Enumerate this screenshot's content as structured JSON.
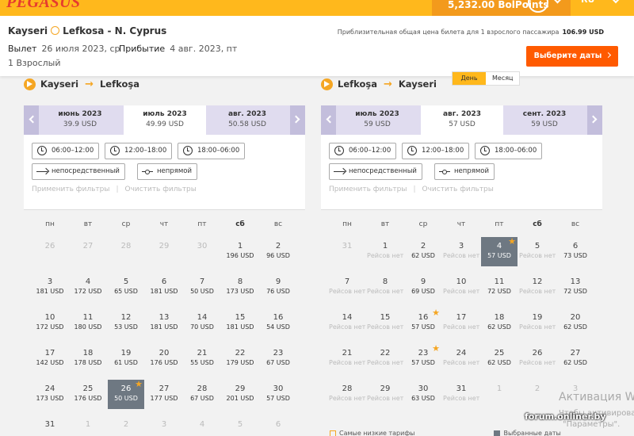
{
  "header": {
    "logo": "PEGASUS",
    "bolpoints": "5,232.00 BolPoints",
    "lang": "RU"
  },
  "summary": {
    "from": "Kayseri",
    "to": "Lefkosa - N. Cyprus",
    "departure_label": "Вылет",
    "departure_date": "26 июля 2023, ср",
    "arrival_label": "Прибытие",
    "arrival_date": "4 авг. 2023, пт",
    "passengers": "1 Взрослый",
    "price_note": "Приблизительная общая цена билета для 1 взрослого пассажира",
    "price": "106.99 USD",
    "select_button": "Выберите даты"
  },
  "view_toggle": {
    "day": "День",
    "month": "Месяц"
  },
  "filters": {
    "time1": "06:00–12:00",
    "time2": "12:00–18:00",
    "time3": "18:00–06:00",
    "direct": "непосредственный",
    "indirect": "непрямой",
    "apply": "Применить фильтры",
    "clear": "Очистить фильтры"
  },
  "weekdays": [
    "пн",
    "вт",
    "ср",
    "чт",
    "пт",
    "сб",
    "вс"
  ],
  "outbound": {
    "from": "Kayseri",
    "to": "Lefkoşa",
    "months": [
      {
        "name": "июнь 2023",
        "price": "39.9 USD"
      },
      {
        "name": "июль 2023",
        "price": "49.99 USD"
      },
      {
        "name": "авг. 2023",
        "price": "50.58 USD"
      }
    ],
    "weeks": [
      [
        {
          "d": "26",
          "muted": true
        },
        {
          "d": "27",
          "muted": true
        },
        {
          "d": "28",
          "muted": true
        },
        {
          "d": "29",
          "muted": true
        },
        {
          "d": "30",
          "muted": true
        },
        {
          "d": "1",
          "p": "196 USD"
        },
        {
          "d": "2",
          "p": "96 USD"
        }
      ],
      [
        {
          "d": "3",
          "p": "181 USD"
        },
        {
          "d": "4",
          "p": "172 USD"
        },
        {
          "d": "5",
          "p": "65 USD"
        },
        {
          "d": "6",
          "p": "181 USD"
        },
        {
          "d": "7",
          "p": "50 USD"
        },
        {
          "d": "8",
          "p": "173 USD"
        },
        {
          "d": "9",
          "p": "76 USD"
        }
      ],
      [
        {
          "d": "10",
          "p": "172 USD"
        },
        {
          "d": "11",
          "p": "180 USD"
        },
        {
          "d": "12",
          "p": "53 USD"
        },
        {
          "d": "13",
          "p": "181 USD"
        },
        {
          "d": "14",
          "p": "70 USD"
        },
        {
          "d": "15",
          "p": "181 USD"
        },
        {
          "d": "16",
          "p": "54 USD"
        }
      ],
      [
        {
          "d": "17",
          "p": "142 USD"
        },
        {
          "d": "18",
          "p": "178 USD"
        },
        {
          "d": "19",
          "p": "61 USD"
        },
        {
          "d": "20",
          "p": "176 USD"
        },
        {
          "d": "21",
          "p": "55 USD"
        },
        {
          "d": "22",
          "p": "179 USD"
        },
        {
          "d": "23",
          "p": "67 USD"
        }
      ],
      [
        {
          "d": "24",
          "p": "173 USD"
        },
        {
          "d": "25",
          "p": "176 USD"
        },
        {
          "d": "26",
          "p": "50 USD",
          "sel": true,
          "star": true
        },
        {
          "d": "27",
          "p": "177 USD"
        },
        {
          "d": "28",
          "p": "67 USD"
        },
        {
          "d": "29",
          "p": "201 USD"
        },
        {
          "d": "30",
          "p": "57 USD"
        }
      ],
      [
        {
          "d": "31"
        },
        {
          "d": "1",
          "muted": true
        },
        {
          "d": "2",
          "muted": true
        },
        {
          "d": "3",
          "muted": true
        },
        {
          "d": "4",
          "muted": true
        },
        {
          "d": "5",
          "muted": true
        },
        {
          "d": "6",
          "muted": true
        }
      ]
    ]
  },
  "inbound": {
    "from": "Lefkoşa",
    "to": "Kayseri",
    "months": [
      {
        "name": "июль 2023",
        "price": "59 USD"
      },
      {
        "name": "авг. 2023",
        "price": "57 USD"
      },
      {
        "name": "сент. 2023",
        "price": "59 USD"
      }
    ],
    "weeks": [
      [
        {
          "d": "31",
          "muted": true
        },
        {
          "d": "1",
          "p": "Рейсов нет",
          "nr": true
        },
        {
          "d": "2",
          "p": "62 USD"
        },
        {
          "d": "3",
          "p": "Рейсов нет",
          "nr": true
        },
        {
          "d": "4",
          "p": "57 USD",
          "sel": true,
          "star": true
        },
        {
          "d": "5",
          "p": "Рейсов нет",
          "nr": true
        },
        {
          "d": "6",
          "p": "73 USD"
        }
      ],
      [
        {
          "d": "7",
          "p": "Рейсов нет",
          "nr": true
        },
        {
          "d": "8",
          "p": "Рейсов нет",
          "nr": true
        },
        {
          "d": "9",
          "p": "69 USD"
        },
        {
          "d": "10",
          "p": "Рейсов нет",
          "nr": true
        },
        {
          "d": "11",
          "p": "72 USD"
        },
        {
          "d": "12",
          "p": "Рейсов нет",
          "nr": true
        },
        {
          "d": "13",
          "p": "72 USD"
        }
      ],
      [
        {
          "d": "14",
          "p": "Рейсов нет",
          "nr": true
        },
        {
          "d": "15",
          "p": "Рейсов нет",
          "nr": true
        },
        {
          "d": "16",
          "p": "57 USD",
          "star": true
        },
        {
          "d": "17",
          "p": "Рейсов нет",
          "nr": true
        },
        {
          "d": "18",
          "p": "62 USD"
        },
        {
          "d": "19",
          "p": "Рейсов нет",
          "nr": true
        },
        {
          "d": "20",
          "p": "62 USD"
        }
      ],
      [
        {
          "d": "21",
          "p": "Рейсов нет",
          "nr": true
        },
        {
          "d": "22",
          "p": "Рейсов нет",
          "nr": true
        },
        {
          "d": "23",
          "p": "57 USD",
          "star": true
        },
        {
          "d": "24",
          "p": "Рейсов нет",
          "nr": true
        },
        {
          "d": "25",
          "p": "62 USD"
        },
        {
          "d": "26",
          "p": "Рейсов нет",
          "nr": true
        },
        {
          "d": "27",
          "p": "62 USD"
        }
      ],
      [
        {
          "d": "28",
          "p": "Рейсов нет",
          "nr": true
        },
        {
          "d": "29",
          "p": "Рейсов нет",
          "nr": true
        },
        {
          "d": "30",
          "p": "63 USD"
        },
        {
          "d": "31",
          "p": "Рейсов нет",
          "nr": true
        },
        {
          "d": "1",
          "muted": true
        },
        {
          "d": "2",
          "muted": true
        },
        {
          "d": "3",
          "muted": true
        }
      ]
    ]
  },
  "legend": {
    "cheapest": "Самые низкие тарифы",
    "selected": "Выбранные даты"
  },
  "overlay": {
    "activation": "Активация W",
    "activation_sub": "Чтобы активировать",
    "params": "\"Параметры\".",
    "forum": "forum.onliner.by"
  }
}
